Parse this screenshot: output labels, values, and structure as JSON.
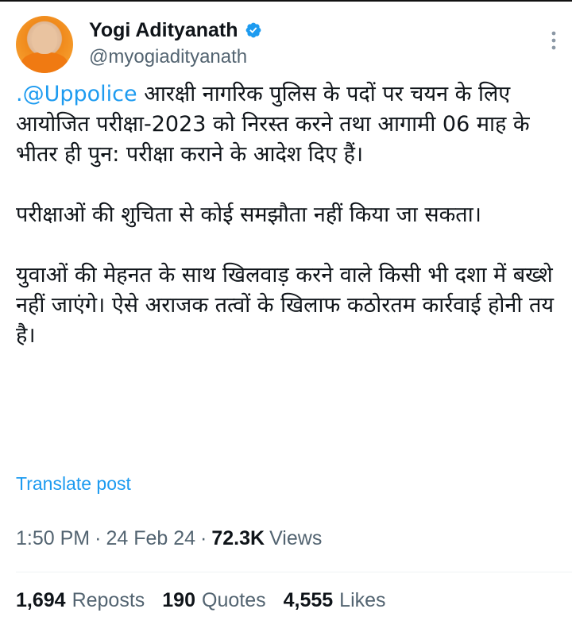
{
  "author": {
    "display_name": "Yogi Adityanath",
    "handle": "@myogiadityanath",
    "verified_icon": "verified-badge-icon",
    "avatar": "avatar"
  },
  "tweet": {
    "mention": ".@Uppolice",
    "para1_rest": " आरक्षी नागरिक पुलिस के पदों पर चयन के लिए आयोजित परीक्षा-2023 को निरस्त करने तथा आगामी 06 माह के भीतर ही पुन: परीक्षा कराने के आदेश दिए हैं।",
    "para2": "परीक्षाओं की शुचिता से कोई समझौता नहीं किया जा सकता।",
    "para3": "युवाओं की मेहनत के साथ खिलवाड़ करने वाले किसी भी दशा में बख्शे नहीं जाएंगे। ऐसे अराजक तत्वों के खिलाफ कठोरतम कार्रवाई होनी तय है।"
  },
  "translate_label": "Translate post",
  "meta": {
    "time": "1:50 PM",
    "date": "24 Feb 24",
    "separator": "·",
    "views_count": "72.3K",
    "views_label": "Views"
  },
  "stats": {
    "reposts_count": "1,694",
    "reposts_label": "Reposts",
    "quotes_count": "190",
    "quotes_label": "Quotes",
    "likes_count": "4,555",
    "likes_label": "Likes"
  },
  "colors": {
    "accent": "#1d9bf0",
    "text": "#0f1419",
    "muted": "#536471"
  }
}
